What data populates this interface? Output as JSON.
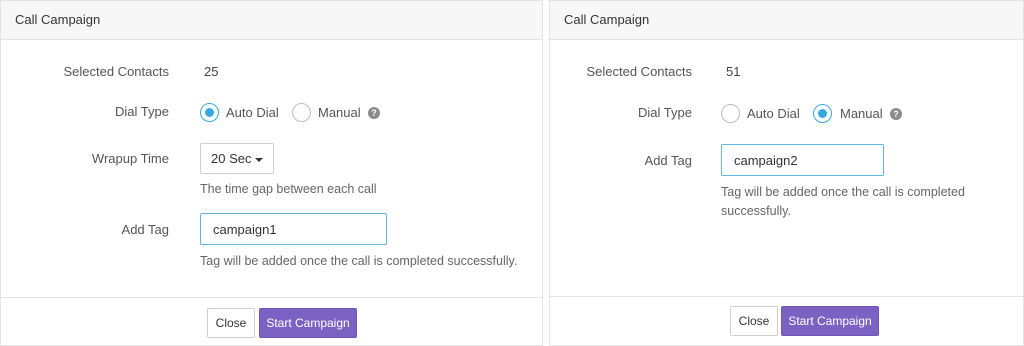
{
  "left": {
    "title": "Call Campaign",
    "selected_contacts_label": "Selected Contacts",
    "selected_contacts_value": "25",
    "dial_type_label": "Dial Type",
    "dial_options": [
      {
        "label": "Auto Dial",
        "checked": true
      },
      {
        "label": "Manual",
        "checked": false
      }
    ],
    "wrapup_label": "Wrapup Time",
    "wrapup_value": "20 Sec",
    "wrapup_hint": "The time gap between each call",
    "add_tag_label": "Add Tag",
    "tag_value": "campaign1",
    "tag_hint": "Tag will be added once the call is completed successfully.",
    "close_label": "Close",
    "start_label": "Start Campaign"
  },
  "right": {
    "title": "Call Campaign",
    "selected_contacts_label": "Selected Contacts",
    "selected_contacts_value": "51",
    "dial_type_label": "Dial Type",
    "dial_options": [
      {
        "label": "Auto Dial",
        "checked": false
      },
      {
        "label": "Manual",
        "checked": true
      }
    ],
    "add_tag_label": "Add Tag",
    "tag_value": "campaign2",
    "tag_hint_line1": "Tag will be added once the call is completed",
    "tag_hint_line2": "successfully.",
    "close_label": "Close",
    "start_label": "Start Campaign"
  },
  "icons": {
    "help": "question-circle-icon",
    "dropdown": "caret-down-icon"
  },
  "colors": {
    "accent": "#35a8dc",
    "primary_button": "#7b61c2",
    "header_bg": "#f7f7f7"
  }
}
